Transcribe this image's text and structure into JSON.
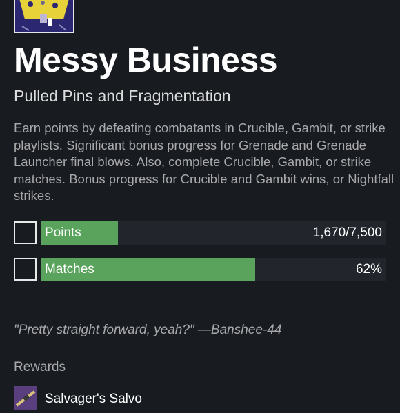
{
  "bounty": {
    "title": "Messy Business",
    "subtitle": "Pulled Pins and Fragmentation",
    "description": "Earn points by defeating combatants in Crucible, Gambit, or strike playlists. Significant bonus progress for Grenade and Grenade Launcher final blows. Also, complete Crucible, Gambit, or strike matches. Bonus progress for Crucible and Gambit wins, or Nightfall strikes."
  },
  "objectives": [
    {
      "label": "Points",
      "value_text": "1,670/7,500",
      "progress": 0.2227,
      "completed": false
    },
    {
      "label": "Matches",
      "value_text": "62%",
      "progress": 0.62,
      "completed": false
    }
  ],
  "quote": "\"Pretty straight forward, yeah?\" —Banshee-44",
  "rewards": {
    "heading": "Rewards",
    "items": [
      {
        "name": "Salvager's Salvo",
        "icon": "grenade-launcher-icon"
      }
    ]
  },
  "colors": {
    "background": "#181c21",
    "progress_fill": "#5aa35d",
    "progress_track": "#22262c",
    "icon_background": "#2b2770",
    "icon_accent": "#e8d23a"
  }
}
